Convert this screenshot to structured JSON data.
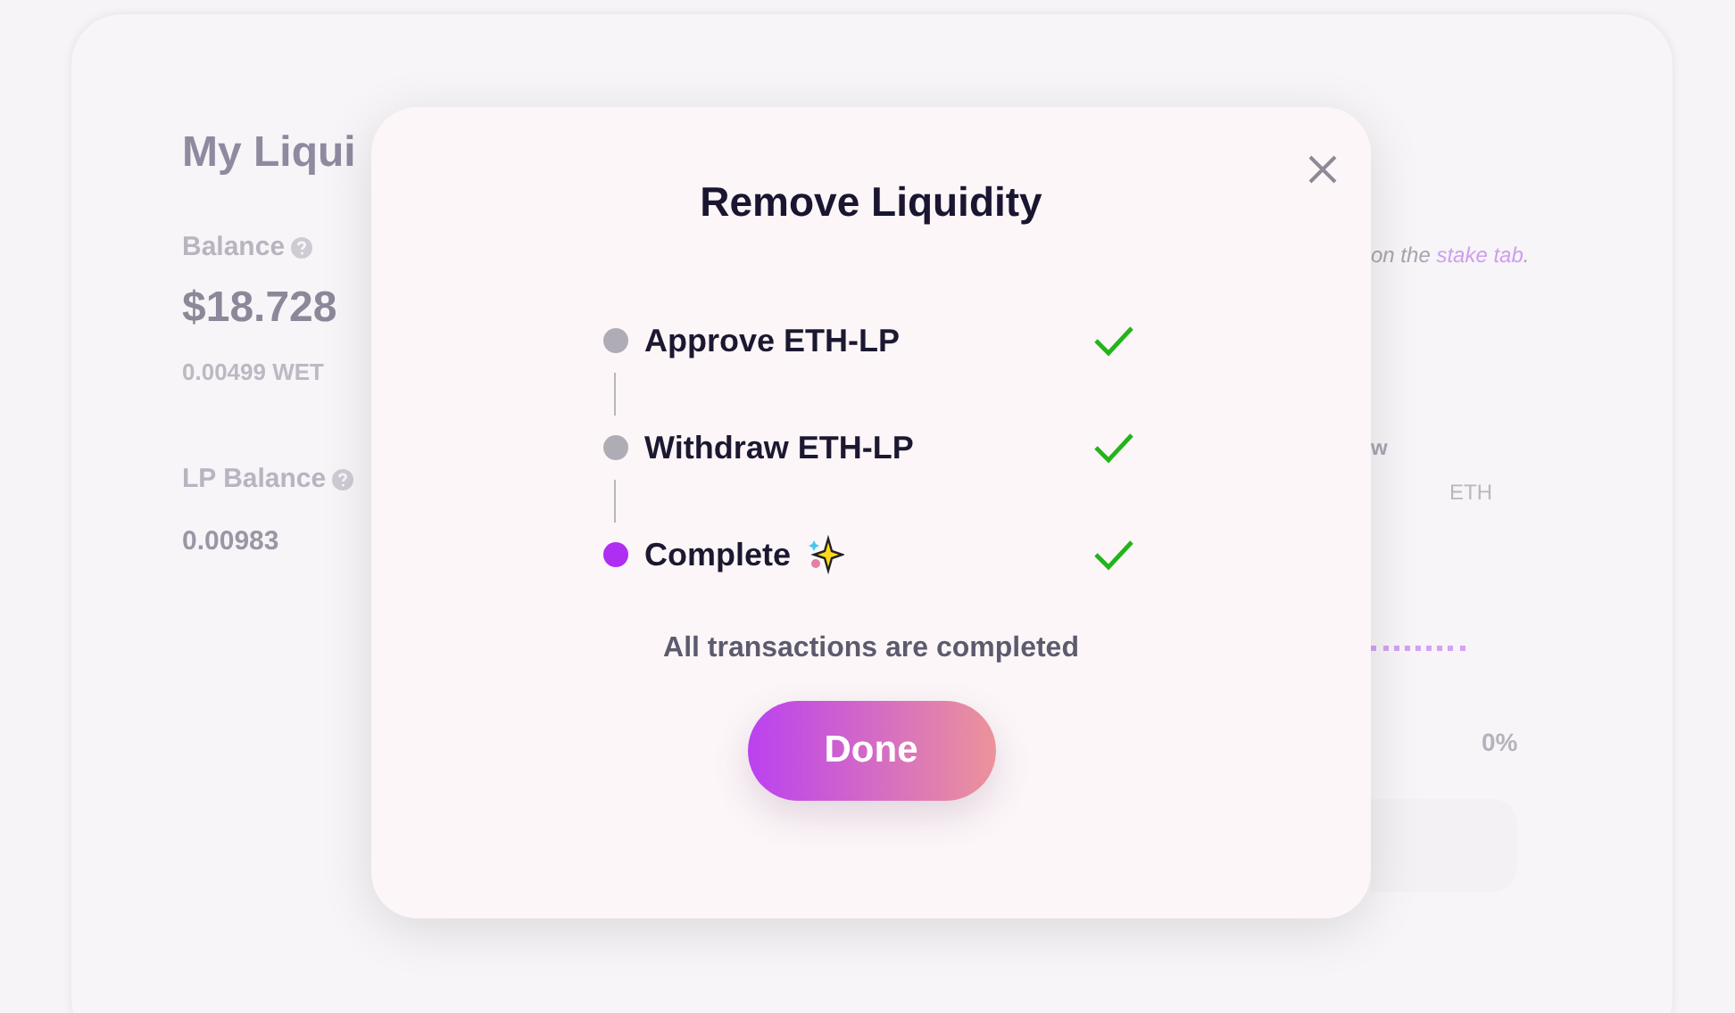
{
  "background": {
    "title": "My Liqui",
    "balance_label": "Balance",
    "balance_value": "$18.728",
    "balance_sub": "0.00499 WET",
    "lp_label": "LP Balance",
    "lp_value": "0.00983",
    "note_text": "on the ",
    "note_link": "stake tab",
    "note_end": ".",
    "right_label": "w",
    "right_sub": "ETH",
    "percent": "0%"
  },
  "modal": {
    "title": "Remove Liquidity",
    "steps": [
      {
        "label": "Approve ETH-LP",
        "current": false,
        "done": true
      },
      {
        "label": "Withdraw ETH-LP",
        "current": false,
        "done": true
      },
      {
        "label": "Complete",
        "current": true,
        "done": true
      }
    ],
    "message": "All transactions are completed",
    "button": "Done"
  }
}
